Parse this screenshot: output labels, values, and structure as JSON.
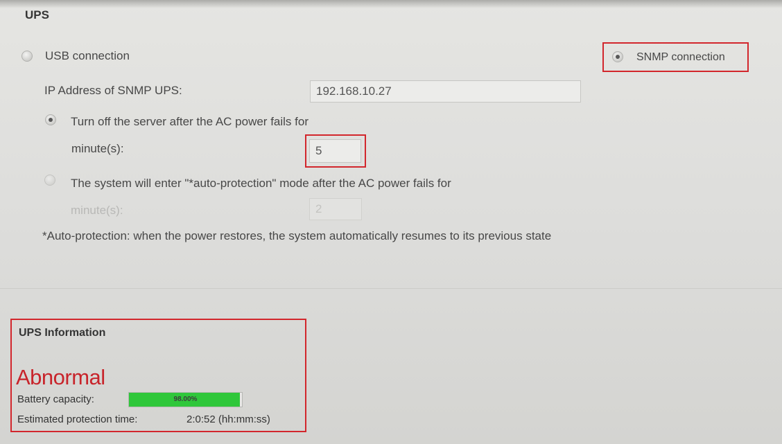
{
  "ups": {
    "title": "UPS",
    "usb_label": "USB connection",
    "snmp_label": "SNMP connection",
    "connection_selected": "SNMP connection",
    "ip_label": "IP Address of SNMP UPS:",
    "ip_value": "192.168.10.27",
    "option_turn_off_label": "Turn off the server after the AC power fails for",
    "option_turn_off_checked": true,
    "turn_off_minutes_label": "minute(s):",
    "turn_off_minutes_value": "5",
    "option_auto_protect_label": "The system will enter \"*auto-protection\" mode after the AC power fails for",
    "option_auto_protect_checked": false,
    "auto_protect_minutes_label": "minute(s):",
    "auto_protect_minutes_value": "2",
    "note": "*Auto-protection: when the power restores, the system automatically resumes to its previous state"
  },
  "ups_info": {
    "title": "UPS Information",
    "status": "Abnormal",
    "battery_label": "Battery capacity:",
    "battery_percent_text": "98.00%",
    "battery_fraction": 0.98,
    "protection_label": "Estimated protection time:",
    "protection_value": "2:0:52 (hh:mm:ss)"
  },
  "colors": {
    "highlight": "#d2262c",
    "status_abnormal": "#c8242b",
    "battery_fill": "#2fc73a"
  }
}
